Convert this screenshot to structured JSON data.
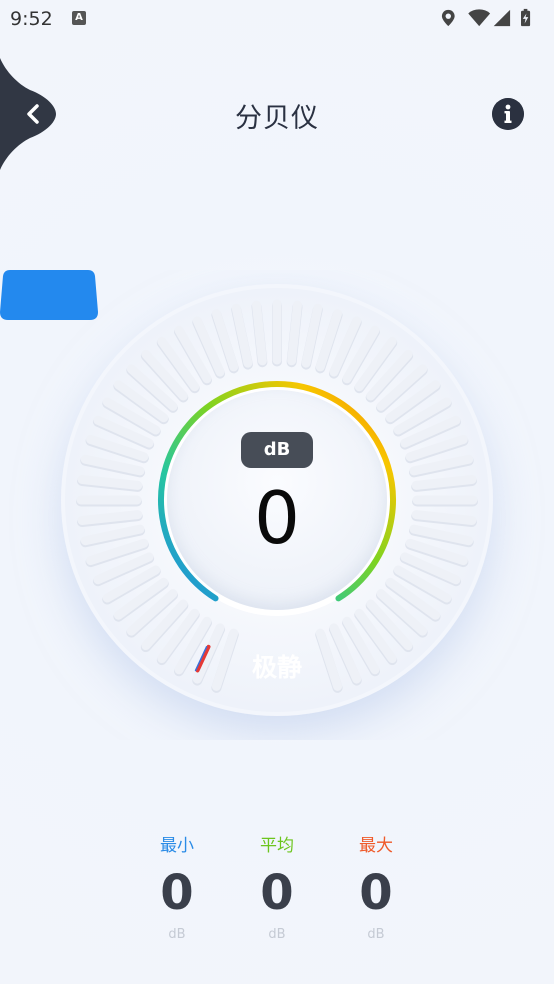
{
  "status_bar": {
    "time": "9:52",
    "notification_icon": "A"
  },
  "header": {
    "title": "分贝仪",
    "back_icon": "chevron-left-icon",
    "info_icon": "info-icon"
  },
  "meter": {
    "unit": "dB",
    "value": "0",
    "level_label": "极静",
    "needle_fraction": 0,
    "ring_colors": [
      "#1e88e5",
      "#26c6a0",
      "#7ed321",
      "#f7c600",
      "#f57c00"
    ],
    "badge_color": "#2389ee"
  },
  "stats": [
    {
      "label": "最小",
      "value": "0",
      "unit": "dB",
      "color": "#2a8be6"
    },
    {
      "label": "平均",
      "value": "0",
      "unit": "dB",
      "color": "#6cc51d"
    },
    {
      "label": "最大",
      "value": "0",
      "unit": "dB",
      "color": "#ef5a2a"
    }
  ]
}
